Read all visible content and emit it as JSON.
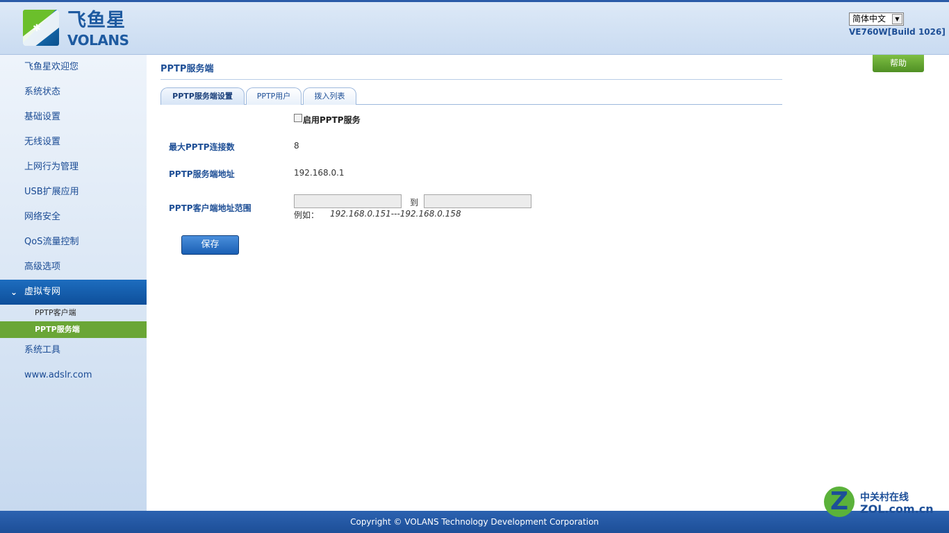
{
  "header": {
    "logo_cn": "飞鱼星",
    "logo_en": "VOLANS",
    "language": "简体中文",
    "version": "VE760W[Build 1026]"
  },
  "sidebar": {
    "items": [
      {
        "label": "飞鱼星欢迎您"
      },
      {
        "label": "系统状态"
      },
      {
        "label": "基础设置"
      },
      {
        "label": "无线设置"
      },
      {
        "label": "上网行为管理"
      },
      {
        "label": "USB扩展应用"
      },
      {
        "label": "网络安全"
      },
      {
        "label": "QoS流量控制"
      },
      {
        "label": "高级选项"
      },
      {
        "label": "虚拟专网",
        "active": true
      },
      {
        "label": "系统工具"
      },
      {
        "label": "www.adslr.com"
      }
    ],
    "sub_items": [
      {
        "label": "PPTP客户端"
      },
      {
        "label": "PPTP服务端",
        "active": true
      }
    ]
  },
  "main": {
    "help_label": "帮助",
    "title": "PPTP服务端",
    "tabs": [
      {
        "label": "PPTP服务端设置",
        "active": true
      },
      {
        "label": "PPTP用户"
      },
      {
        "label": "拨入列表"
      }
    ],
    "enable_label": "启用PPTP服务",
    "enable_checked": false,
    "max_conn_label": "最大PPTP连接数",
    "max_conn_value": "8",
    "server_addr_label": "PPTP服务端地址",
    "server_addr_value": "192.168.0.1",
    "client_range_label": "PPTP客户端地址范围",
    "range_start": "",
    "range_end": "",
    "range_to": "到",
    "example_label": "例如：",
    "example_value": "192.168.0.151---192.168.0.158",
    "save_label": "保存"
  },
  "footer": {
    "copyright": "Copyright © VOLANS Technology Development Corporation"
  },
  "watermark": {
    "cn": "中关村在线",
    "en": "ZOL.com.cn"
  }
}
